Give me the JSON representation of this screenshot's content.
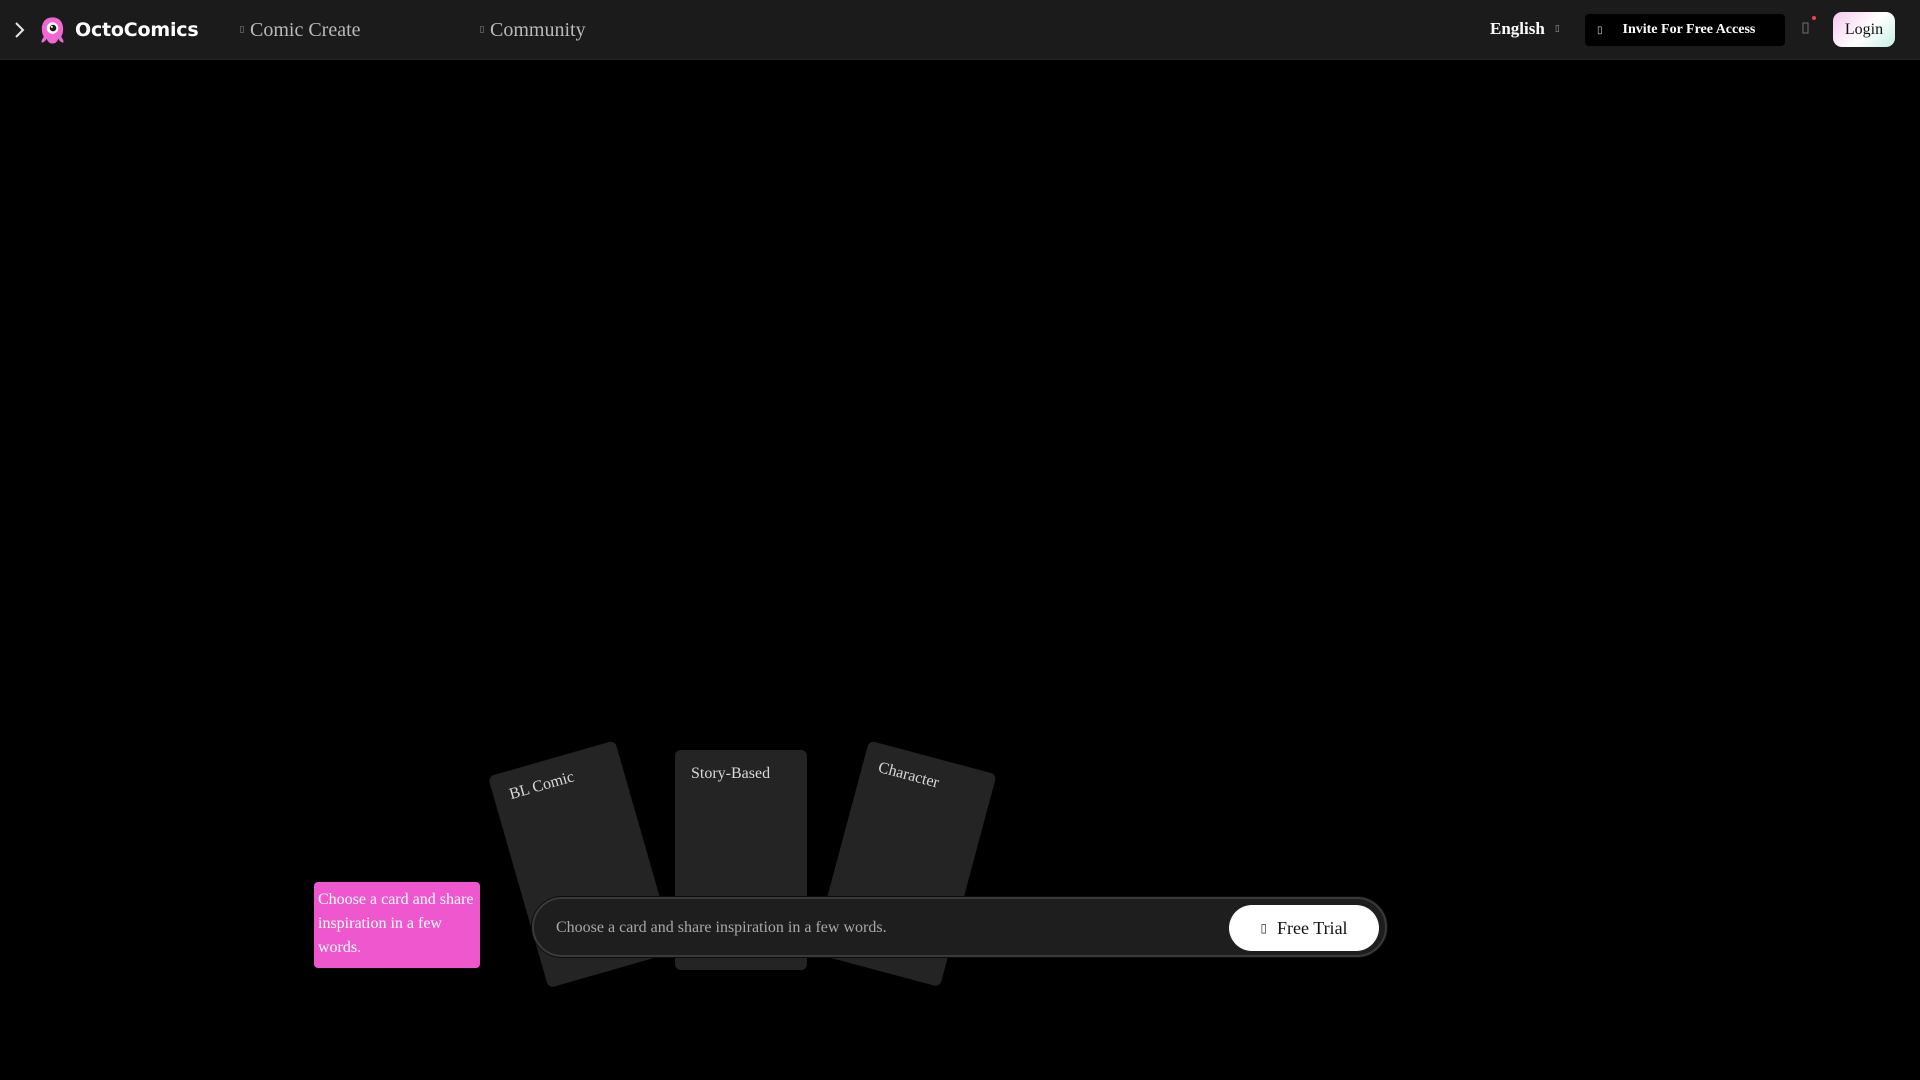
{
  "header": {
    "brand": "OctoComics",
    "nav": [
      {
        "label": "Comic Create",
        "icon": "pen-icon"
      },
      {
        "label": "Community",
        "icon": "compass-icon"
      }
    ],
    "language": "English",
    "invite_label": "Invite For Free Access",
    "login_label": "Login"
  },
  "cards": [
    {
      "label": "BL Comic"
    },
    {
      "label": "Story-Based"
    },
    {
      "label": "Character"
    }
  ],
  "prompt": {
    "placeholder": "Choose a card and share inspiration in a few words.",
    "submit_label": "Free Trial"
  },
  "tooltip": {
    "text": "Choose a card and share inspiration in a few words."
  },
  "colors": {
    "accent_pink": "#ef57cf",
    "brand_pink": "#f067d4",
    "notification_dot": "#ff3b4e"
  }
}
